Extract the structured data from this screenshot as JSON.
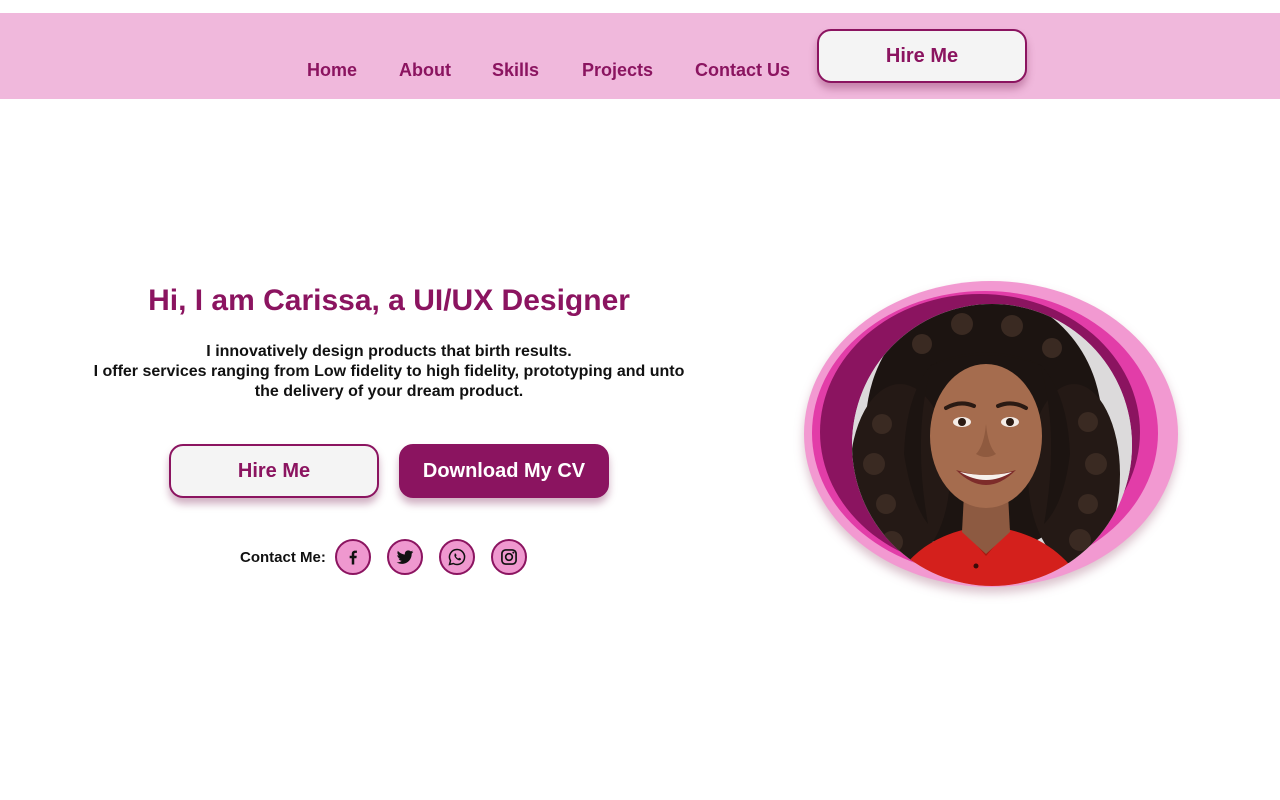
{
  "nav": {
    "links": [
      {
        "label": "Home"
      },
      {
        "label": "About"
      },
      {
        "label": "Skills"
      },
      {
        "label": "Projects"
      },
      {
        "label": "Contact Us"
      }
    ],
    "hire_label": "Hire Me"
  },
  "hero": {
    "title": "Hi, I am Carissa, a UI/UX Designer",
    "desc_line1": "I innovatively design products that birth results.",
    "desc_line2": "I offer services ranging from Low fidelity to high fidelity, prototyping and unto the delivery of your dream product.",
    "hire_label": "Hire Me",
    "cv_label": "Download My CV",
    "contact_label": "Contact Me:",
    "socials": [
      {
        "icon": "facebook-icon"
      },
      {
        "icon": "twitter-icon"
      },
      {
        "icon": "whatsapp-icon"
      },
      {
        "icon": "instagram-icon"
      }
    ]
  },
  "colors": {
    "brand": "#8b1460",
    "nav_bg": "#f0b8dc",
    "accent_pink": "#e23da8",
    "light_pink": "#f299d1",
    "button_light": "#f4f4f4"
  },
  "portrait": {
    "subject": "smiling woman in red top"
  }
}
